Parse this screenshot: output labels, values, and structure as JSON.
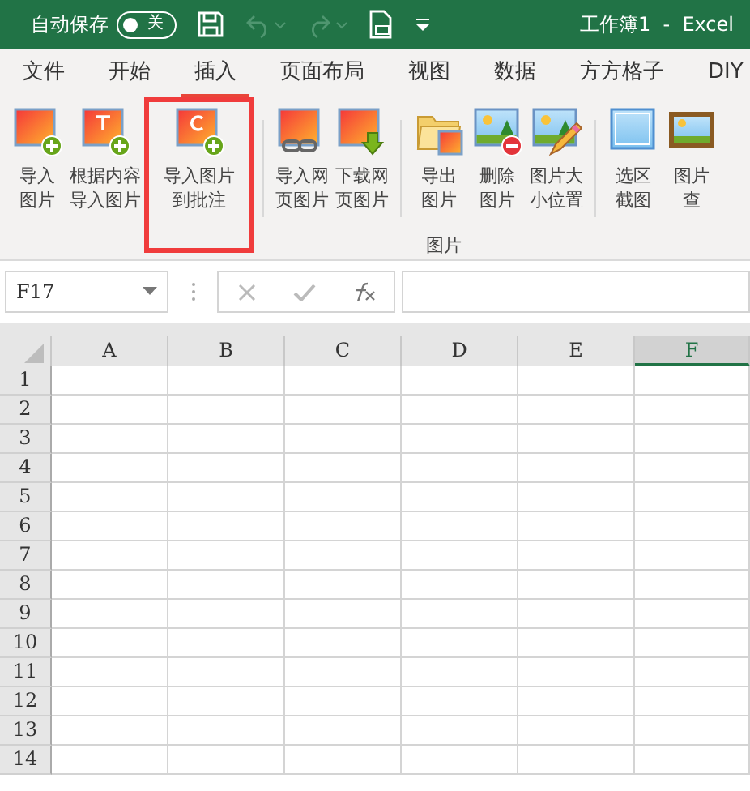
{
  "title_bar": {
    "autosave_label": "自动保存",
    "autosave_toggle": {
      "on": false,
      "label": "关"
    },
    "undo_disabled": true,
    "redo_disabled": true,
    "title": "工作簿1  -  Excel"
  },
  "tabs": [
    {
      "label": "文件",
      "selected": false
    },
    {
      "label": "开始",
      "selected": false
    },
    {
      "label": "插入",
      "selected": true
    },
    {
      "label": "页面布局",
      "selected": false
    },
    {
      "label": "视图",
      "selected": false
    },
    {
      "label": "数据",
      "selected": false
    },
    {
      "label": "方方格子",
      "selected": false
    },
    {
      "label": "DIY",
      "selected": false
    }
  ],
  "ribbon": {
    "group_label": "图片",
    "buttons": [
      {
        "label": "导入图片",
        "highlighted": false
      },
      {
        "label": "根据内容导入图片",
        "highlighted": false
      },
      {
        "label": "导入图片到批注",
        "highlighted": true
      },
      {
        "label": "导入网页图片",
        "highlighted": false
      },
      {
        "label": "下载网页图片",
        "highlighted": false
      },
      {
        "label": "导出图片",
        "highlighted": false
      },
      {
        "label": "删除图片",
        "highlighted": false
      },
      {
        "label": "图片大小位置",
        "highlighted": false
      },
      {
        "label": "选区截图",
        "highlighted": false
      },
      {
        "label": "图片查",
        "highlighted": false
      }
    ]
  },
  "formula_bar": {
    "name_box": "F17"
  },
  "sheet": {
    "columns": [
      {
        "label": "A",
        "selected": false
      },
      {
        "label": "B",
        "selected": false
      },
      {
        "label": "C",
        "selected": false
      },
      {
        "label": "D",
        "selected": false
      },
      {
        "label": "E",
        "selected": false
      },
      {
        "label": "F",
        "selected": true
      }
    ],
    "rows": [
      "1",
      "2",
      "3",
      "4",
      "5",
      "6",
      "7",
      "8",
      "9",
      "10",
      "11",
      "12",
      "13",
      "14"
    ]
  }
}
